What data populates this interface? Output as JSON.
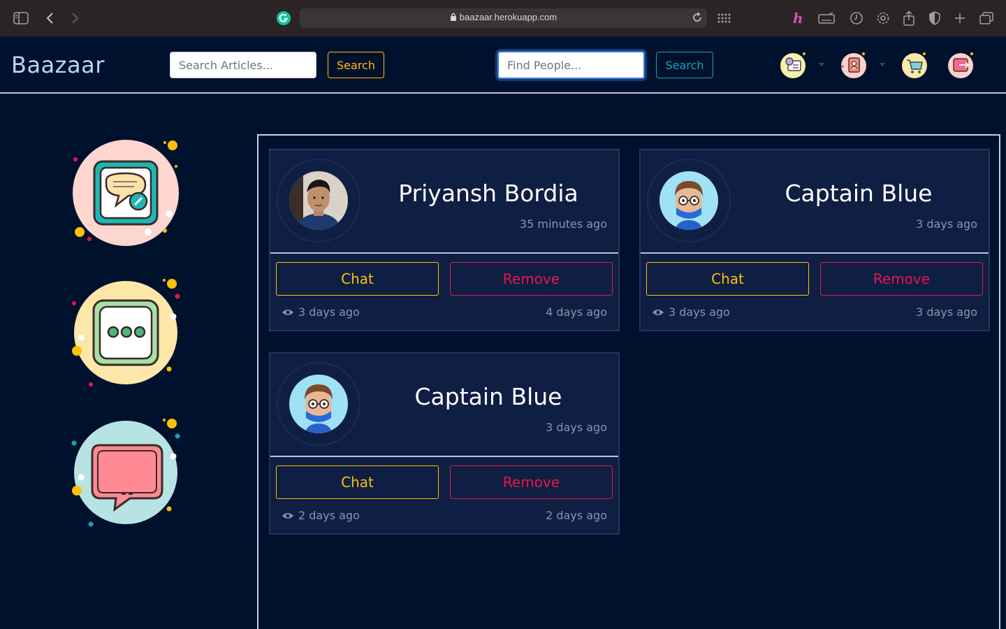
{
  "browser": {
    "url": "baazaar.herokuapp.com"
  },
  "navbar": {
    "brand": "Baazaar",
    "article_search": {
      "placeholder": "Search Articles...",
      "button": "Search"
    },
    "people_search": {
      "placeholder": "Find People...",
      "button": "Search"
    },
    "icons": [
      "settings-menu-icon",
      "contacts-book-icon",
      "shopping-cart-icon",
      "logout-icon"
    ]
  },
  "sidebar": {
    "icons": [
      "new-message-icon",
      "typing-chat-icon",
      "chat-bubble-icon"
    ]
  },
  "colors": {
    "background": "#00112e",
    "card": "#0f1e43",
    "accent_yellow": "#ffc107",
    "accent_red": "#e8164a",
    "accent_teal": "#17a2b8"
  },
  "friends": [
    {
      "name": "Priyansh Bordia",
      "ago": "35 minutes ago",
      "chat": "Chat",
      "remove": "Remove",
      "seen": "3 days ago",
      "since": "4 days ago"
    },
    {
      "name": "Captain Blue",
      "ago": "3 days ago",
      "chat": "Chat",
      "remove": "Remove",
      "seen": "3 days ago",
      "since": "3 days ago"
    },
    {
      "name": "Captain Blue",
      "ago": "3 days ago",
      "chat": "Chat",
      "remove": "Remove",
      "seen": "2 days ago",
      "since": "2 days ago"
    }
  ]
}
